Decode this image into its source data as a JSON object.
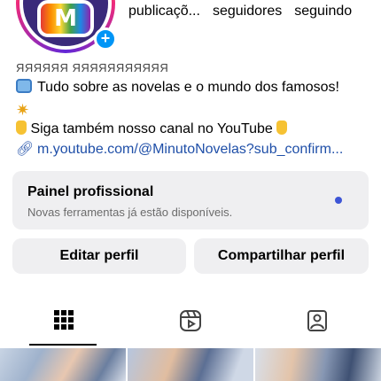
{
  "profile": {
    "stats": {
      "posts_label": "publicaçõ...",
      "followers_label": "seguidores",
      "following_label": "seguindo"
    },
    "avatar_letter": "M",
    "name": "ЯЯЯЯЯЯ ЯЯЯЯЯЯЯЯЯЯЯ",
    "bio": {
      "line1": "Tudo sobre as novelas e o mundo dos famosos!",
      "line3": "Siga também nosso canal no YouTube",
      "link": "m.youtube.com/@MinutoNovelas?sub_confirm..."
    }
  },
  "panel": {
    "title": "Painel profissional",
    "subtitle": "Novas ferramentas já estão disponíveis."
  },
  "buttons": {
    "edit": "Editar perfil",
    "share": "Compartilhar perfil"
  },
  "tabs": [
    {
      "icon": "grid-icon",
      "active": true
    },
    {
      "icon": "reels-icon",
      "active": false
    },
    {
      "icon": "tagged-icon",
      "active": false
    }
  ],
  "colors": {
    "link": "#1f4fa8",
    "accent": "#0095f6",
    "panel_bg": "#efeff1",
    "notification_dot": "#3d55d6"
  }
}
